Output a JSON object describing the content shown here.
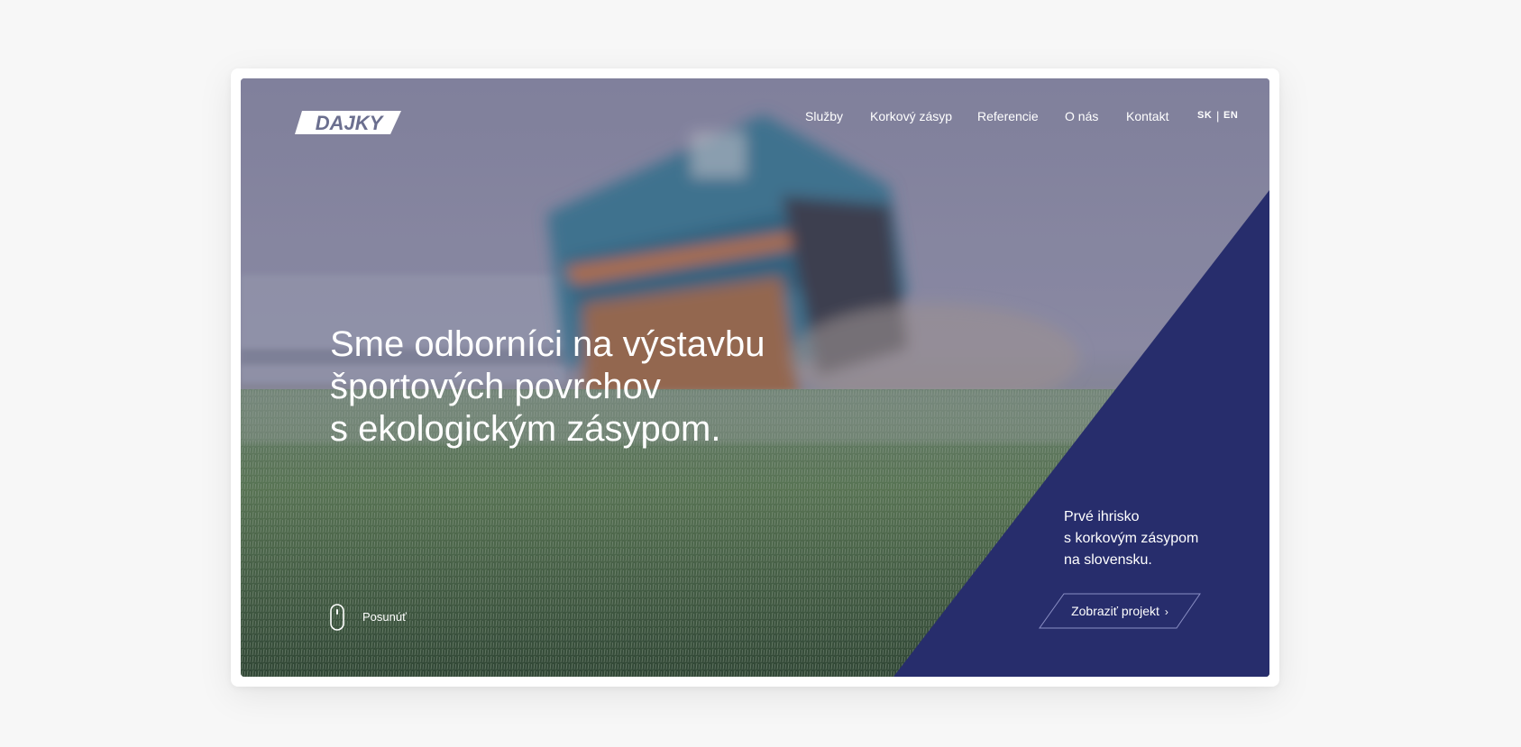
{
  "brand": {
    "logo_text": "DAJKY"
  },
  "nav": {
    "items": [
      {
        "label": "Služby"
      },
      {
        "label": "Korkový zásyp"
      },
      {
        "label": "Referencie"
      },
      {
        "label": "O nás"
      },
      {
        "label": "Kontakt"
      }
    ],
    "languages": {
      "sk": "SK",
      "separator": "|",
      "en": "EN"
    }
  },
  "hero": {
    "headline_lines": [
      "Sme odborníci na výstavbu",
      "športových povrchov",
      "s ekologickým zásypom."
    ],
    "scroll_label": "Posunúť"
  },
  "promo": {
    "lines": [
      "Prvé ihrisko",
      "s korkovým zásypom",
      "na slovensku."
    ],
    "cta_label": "Zobraziť projekt",
    "cta_icon": "chevron-right-icon"
  },
  "colors": {
    "accent": "#272d6c",
    "background": "#f7f7f7",
    "text_on_dark": "#ffffff"
  }
}
